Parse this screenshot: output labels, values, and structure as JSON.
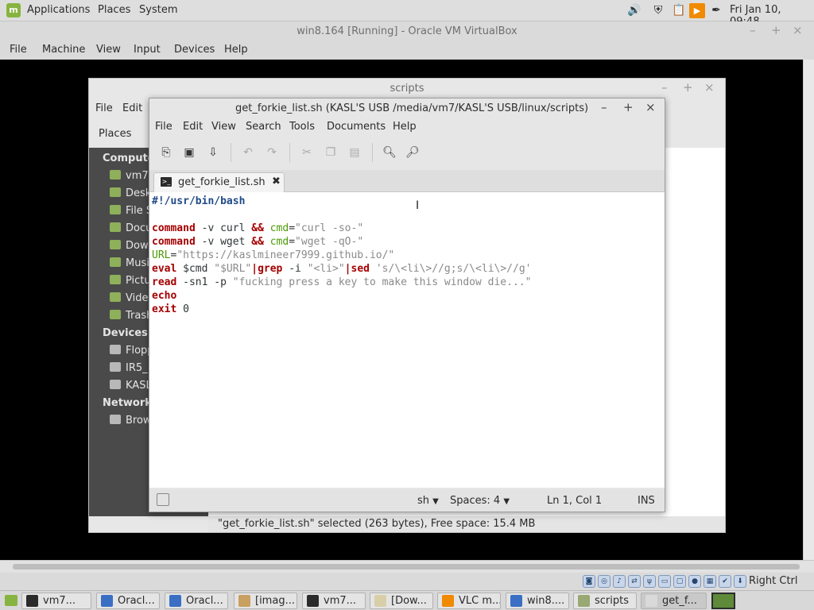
{
  "top_panel": {
    "menus": [
      "Applications",
      "Places",
      "System"
    ],
    "clock": "Fri Jan 10, 09:48"
  },
  "vbox": {
    "title": "win8.164 [Running] - Oracle VM VirtualBox",
    "menu": [
      "File",
      "Machine",
      "View",
      "Input",
      "Devices",
      "Help"
    ],
    "host_key": "Right Ctrl"
  },
  "nemo": {
    "title": "scripts",
    "menu": [
      "File",
      "Edit"
    ],
    "places_label": "Places",
    "sidebar": {
      "computer_label": "Compute",
      "computer_items": [
        "vm7",
        "Desk",
        "File S",
        "Docu",
        "Dow",
        "Musi",
        "Pictu",
        "Vide",
        "Trash"
      ],
      "devices_label": "Devices",
      "devices_items": [
        "Flopp",
        "IR5_",
        "KASL"
      ],
      "network_label": "Network",
      "network_items": [
        "Brow"
      ]
    },
    "status": "\"get_forkie_list.sh\" selected (263 bytes), Free space: 15.4 MB"
  },
  "gedit": {
    "title": "get_forkie_list.sh (KASL'S USB /media/vm7/KASL'S USB/linux/scripts)",
    "menu": [
      "File",
      "Edit",
      "View",
      "Search",
      "Tools",
      "Documents",
      "Help"
    ],
    "tab_label": "get_forkie_list.sh",
    "tab_close": "✖",
    "status": {
      "language": "sh",
      "spaces": "Spaces: 4",
      "position": "Ln 1, Col 1",
      "mode": "INS"
    }
  },
  "code_lines": [
    [
      {
        "t": "#!/usr/bin/bash",
        "c": "shebang"
      }
    ],
    [],
    [
      {
        "t": "command",
        "c": "kw"
      },
      {
        "t": " -v curl ",
        "c": "plain"
      },
      {
        "t": "&&",
        "c": "kw"
      },
      {
        "t": " ",
        "c": "plain"
      },
      {
        "t": "cmd",
        "c": "var"
      },
      {
        "t": "=",
        "c": "plain"
      },
      {
        "t": "\"curl -so-\"",
        "c": "str"
      }
    ],
    [
      {
        "t": "command",
        "c": "kw"
      },
      {
        "t": " -v wget ",
        "c": "plain"
      },
      {
        "t": "&&",
        "c": "kw"
      },
      {
        "t": " ",
        "c": "plain"
      },
      {
        "t": "cmd",
        "c": "var"
      },
      {
        "t": "=",
        "c": "plain"
      },
      {
        "t": "\"wget -qO-\"",
        "c": "str"
      }
    ],
    [
      {
        "t": "URL",
        "c": "var"
      },
      {
        "t": "=",
        "c": "plain"
      },
      {
        "t": "\"https://kaslmineer7999.github.io/\"",
        "c": "str"
      }
    ],
    [
      {
        "t": "eval",
        "c": "kw"
      },
      {
        "t": " $cmd ",
        "c": "plain"
      },
      {
        "t": "\"$URL\"",
        "c": "str"
      },
      {
        "t": "|grep",
        "c": "kw"
      },
      {
        "t": " -i ",
        "c": "plain"
      },
      {
        "t": "\"<li>\"",
        "c": "str"
      },
      {
        "t": "|sed",
        "c": "kw"
      },
      {
        "t": " ",
        "c": "plain"
      },
      {
        "t": "'s/\\<li\\>//g;s/\\<li\\>//g'",
        "c": "str"
      }
    ],
    [
      {
        "t": "read",
        "c": "kw"
      },
      {
        "t": " -sn1 -p ",
        "c": "plain"
      },
      {
        "t": "\"fucking press a key to make this window die...\"",
        "c": "str"
      }
    ],
    [
      {
        "t": "echo",
        "c": "kw"
      }
    ],
    [
      {
        "t": "exit",
        "c": "kw"
      },
      {
        "t": " 0",
        "c": "plain"
      }
    ]
  ],
  "taskbar": [
    {
      "label": "vm7...",
      "color": "#2b2b2b"
    },
    {
      "label": "Oracl...",
      "color": "#3a6fc4"
    },
    {
      "label": "Oracl...",
      "color": "#3a6fc4"
    },
    {
      "label": "[imag...",
      "color": "#c8a060"
    },
    {
      "label": "vm7...",
      "color": "#2b2b2b"
    },
    {
      "label": "[Dow...",
      "color": "#d8cfa8"
    },
    {
      "label": "VLC m...",
      "color": "#f08a00"
    },
    {
      "label": "win8....",
      "color": "#3a6fc4"
    },
    {
      "label": "scripts",
      "color": "#9aa873"
    },
    {
      "label": "get_f...",
      "color": "#d9d9d9"
    }
  ],
  "colors": {
    "keyword": "#a40000",
    "string": "#8a8a8a",
    "variable": "#4e9a06",
    "shebang": "#204a87",
    "sidebar_bg": "#4a4a4a",
    "mint_green": "#87b440"
  }
}
